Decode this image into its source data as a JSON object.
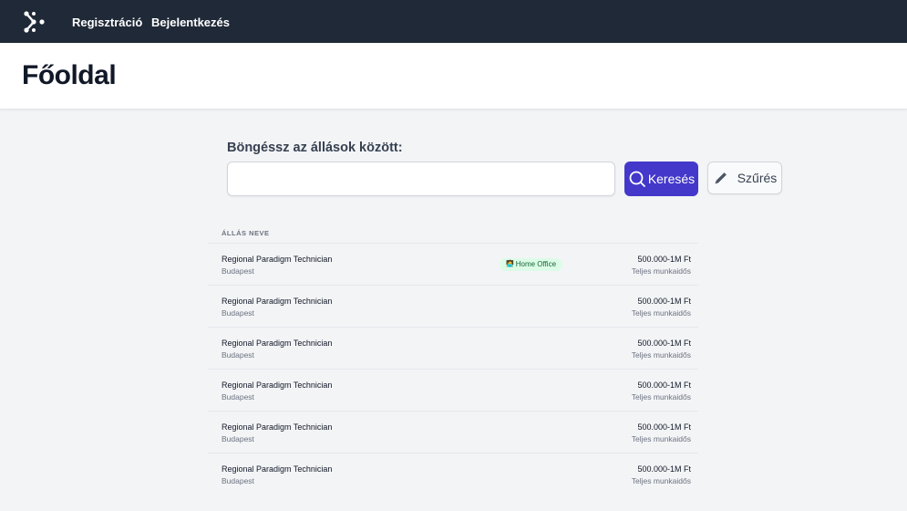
{
  "nav": {
    "logo": "logo-icon",
    "links": [
      {
        "label": "Regisztráció"
      },
      {
        "label": "Bejelentkezés"
      }
    ]
  },
  "header": {
    "title": "Főoldal"
  },
  "search": {
    "label": "Böngéssz az állások között:",
    "value": "",
    "placeholder": "",
    "search_button": "Keresés",
    "search_icon": "search-icon",
    "filter_button": "Szűrés",
    "filter_icon": "pencil-icon"
  },
  "jobs": {
    "column_header": "ÁLLÁS NEVE",
    "rows": [
      {
        "title": "Regional Paradigm Technician",
        "city": "Budapest",
        "salary": "500.000-1M Ft",
        "type": "Teljes munkaidős",
        "badge": "Home Office",
        "badge_icon": "person-at-laptop-icon"
      },
      {
        "title": "Regional Paradigm Technician",
        "city": "Budapest",
        "salary": "500.000-1M Ft",
        "type": "Teljes munkaidős"
      },
      {
        "title": "Regional Paradigm Technician",
        "city": "Budapest",
        "salary": "500.000-1M Ft",
        "type": "Teljes munkaidős"
      },
      {
        "title": "Regional Paradigm Technician",
        "city": "Budapest",
        "salary": "500.000-1M Ft",
        "type": "Teljes munkaidős"
      },
      {
        "title": "Regional Paradigm Technician",
        "city": "Budapest",
        "salary": "500.000-1M Ft",
        "type": "Teljes munkaidős"
      },
      {
        "title": "Regional Paradigm Technician",
        "city": "Budapest",
        "salary": "500.000-1M Ft",
        "type": "Teljes munkaidős"
      }
    ]
  },
  "colors": {
    "nav_bg": "#1f2937",
    "primary": "#4338ca",
    "badge_bg": "#dcfce7",
    "badge_text": "#166534",
    "page_bg": "#f3f4f6"
  }
}
